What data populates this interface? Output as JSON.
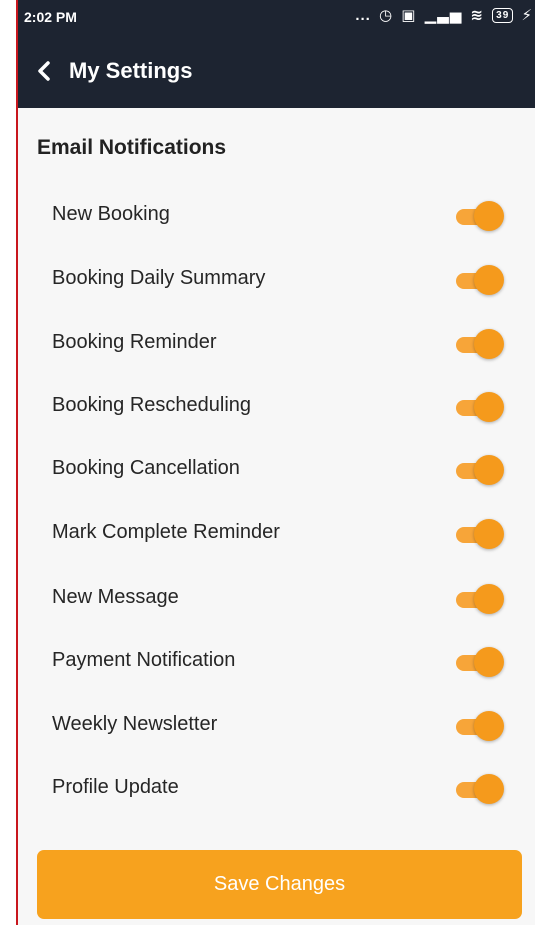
{
  "status_bar": {
    "time": "2:02 PM",
    "icons": [
      "more-dots-icon",
      "alarm-icon",
      "volte-icon",
      "signal-icon",
      "wifi-icon",
      "battery-icon",
      "charging-icon"
    ],
    "dots": "...",
    "battery_level": "39"
  },
  "header": {
    "title": "My Settings",
    "back_icon": "chevron-left-icon"
  },
  "section": {
    "title": "Email Notifications"
  },
  "notifications": [
    {
      "label": "New Booking",
      "enabled": true
    },
    {
      "label": "Booking Daily Summary",
      "enabled": true
    },
    {
      "label": "Booking Reminder",
      "enabled": true
    },
    {
      "label": "Booking Rescheduling",
      "enabled": true
    },
    {
      "label": "Booking Cancellation",
      "enabled": true
    },
    {
      "label": "Mark Complete Reminder",
      "enabled": true
    },
    {
      "label": "New Message",
      "enabled": true
    },
    {
      "label": "Payment Notification",
      "enabled": true
    },
    {
      "label": "Weekly Newsletter",
      "enabled": true
    },
    {
      "label": "Profile Update",
      "enabled": true
    }
  ],
  "actions": {
    "save_label": "Save Changes"
  },
  "colors": {
    "header_bg": "#1d2431",
    "accent": "#f7a21e",
    "background": "#f7f7f7"
  }
}
